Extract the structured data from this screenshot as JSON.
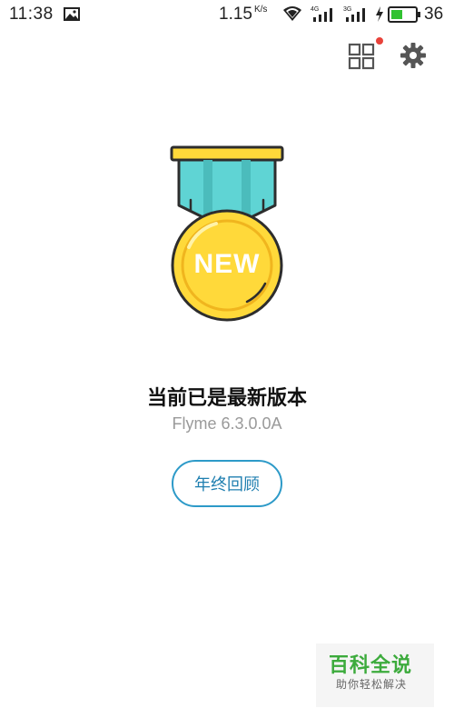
{
  "status_bar": {
    "time": "11:38",
    "speed": "1.15",
    "speed_unit": "K/s",
    "net1": "4G",
    "net2": "3G",
    "battery": "36",
    "image_icon": "image-icon",
    "wifi_icon": "wifi-icon",
    "charge_icon": "lightning-icon",
    "battery_icon": "battery-icon"
  },
  "toolbar": {
    "grid_icon": "grid-icon",
    "settings_icon": "gear-icon",
    "has_notification": true
  },
  "medal": {
    "text": "NEW",
    "colors": {
      "ribbon": "#5fd4d4",
      "gold": "#ffd93a",
      "outline": "#2d2d2d"
    }
  },
  "main": {
    "title": "当前已是最新版本",
    "version": "Flyme 6.3.0.0A",
    "review_button": "年终回顾"
  },
  "watermark": {
    "title": "百科全说",
    "subtitle": "助你轻松解决"
  },
  "colors": {
    "accent": "#2d9ac8",
    "notification_dot": "#e8423a",
    "battery_green": "#31c231"
  }
}
